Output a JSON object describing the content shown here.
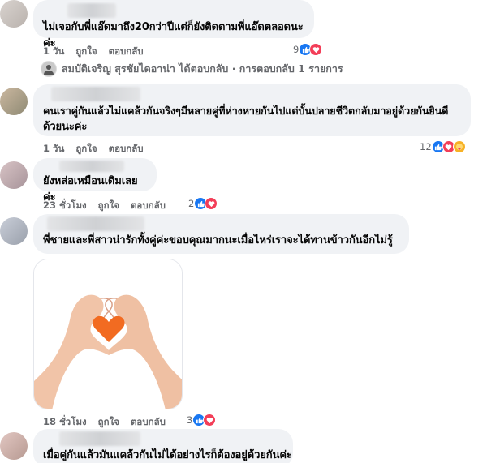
{
  "comments": [
    {
      "text": "ไม่เจอกับพี่แอ๊ดมาถึง20กว่าปีแต่ก็ยังติดตามพี่แอ๊ดตลอดนะค่ะ",
      "time": "1 วัน",
      "like": "ถูกใจ",
      "reply": "ตอบกลับ",
      "reactions": "9",
      "reply_summary": "สมบัติเจริญ สุรชัยไดอาน่า ได้ตอบกลับ · การตอบกลับ 1 รายการ"
    },
    {
      "text_line1": "คนเราคู่กันแล้วไม่แคล้วกันจริงๆมีหลายคู่ที่ห่างหายกันไปแต่บั้นปลายชีวิตกลับมาอยู่ด้วยกันยินดี",
      "text_line2": "ด้วยนะค่ะ",
      "time": "1 วัน",
      "like": "ถูกใจ",
      "reply": "ตอบกลับ",
      "reactions": "12"
    },
    {
      "text": "ยังหล่อเหมือนเดิมเลยค่ะ",
      "time": "23 ชั่วโมง",
      "like": "ถูกใจ",
      "reply": "ตอบกลับ",
      "reactions": "2"
    },
    {
      "text": "พี่ชายและพี่สาวน่ารักทั้งคู่ค่ะขอบคุณมากนะเมื่อไหร่เราจะได้ทานข้าวกันอีกไม่รู้",
      "time": "18 ชั่วโมง",
      "like": "ถูกใจ",
      "reply": "ตอบกลับ",
      "reactions": "3"
    },
    {
      "text": "เมื่อคู่กันแล้วมันแคล้วกันไม่ได้อย่างไรก็ต้องอยู่ด้วยกันค่ะ"
    }
  ],
  "colors": {
    "like": "#1877f2",
    "love": "#f33e58",
    "care": "#f7b125",
    "bubble": "#f0f2f5",
    "meta": "#65676b"
  },
  "icons": [
    "like-icon",
    "love-icon",
    "care-icon",
    "heart-hands-image"
  ]
}
